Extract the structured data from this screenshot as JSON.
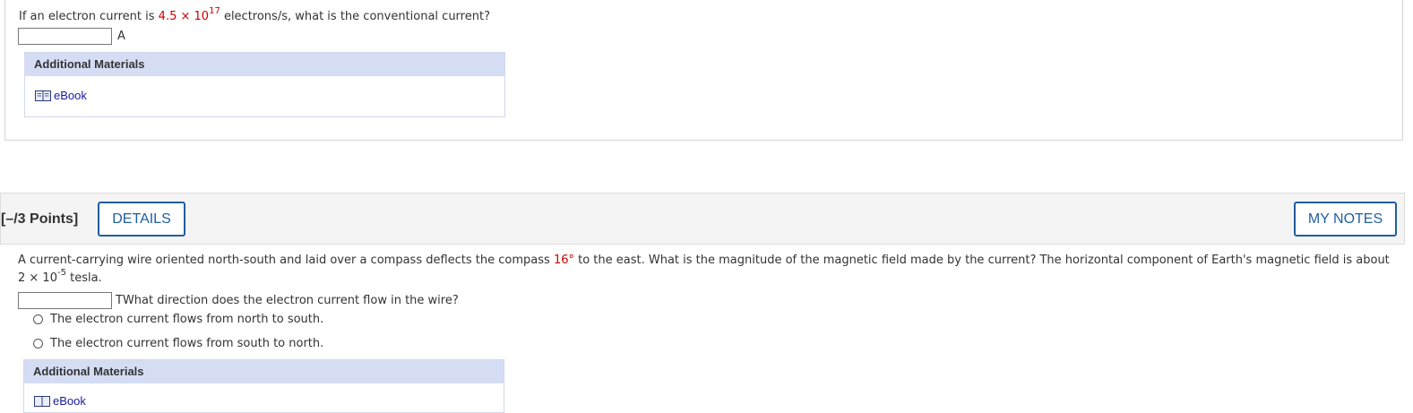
{
  "q1": {
    "text_before": "If an electron current is ",
    "value_coef": "4.5",
    "times": " × ",
    "value_base": "10",
    "value_exp": "17",
    "text_after": " electrons/s, what is the conventional current?",
    "answer_value": "",
    "unit": "A",
    "additional_materials": "Additional Materials",
    "ebook_label": "eBook"
  },
  "q2": {
    "points": "[–/3 Points]",
    "details_label": "DETAILS",
    "my_notes_label": "MY NOTES",
    "text_part1": "A current-carrying wire oriented north-south and laid over a compass deflects the compass ",
    "angle": "16°",
    "text_part2": " to the east. What is the magnitude of the magnetic field made by the current? The horizontal component of Earth's magnetic field is about",
    "field_coef": "2 × 10",
    "field_exp": "-5",
    "field_unit": " tesla.",
    "answer_value": "",
    "unit_and_question": "TWhat direction does the electron current flow in the wire?",
    "option1": "The electron current flows from north to south.",
    "option2": "The electron current flows from south to north.",
    "additional_materials": "Additional Materials",
    "ebook_label": "eBook"
  },
  "colors": {
    "highlight_red": "#cc0000",
    "button_blue": "#1f5f9e",
    "materials_header_bg": "#d5ddf5",
    "link_blue": "#1a1aa6"
  },
  "icons": [
    "ebook-icon",
    "radio-icon"
  ]
}
